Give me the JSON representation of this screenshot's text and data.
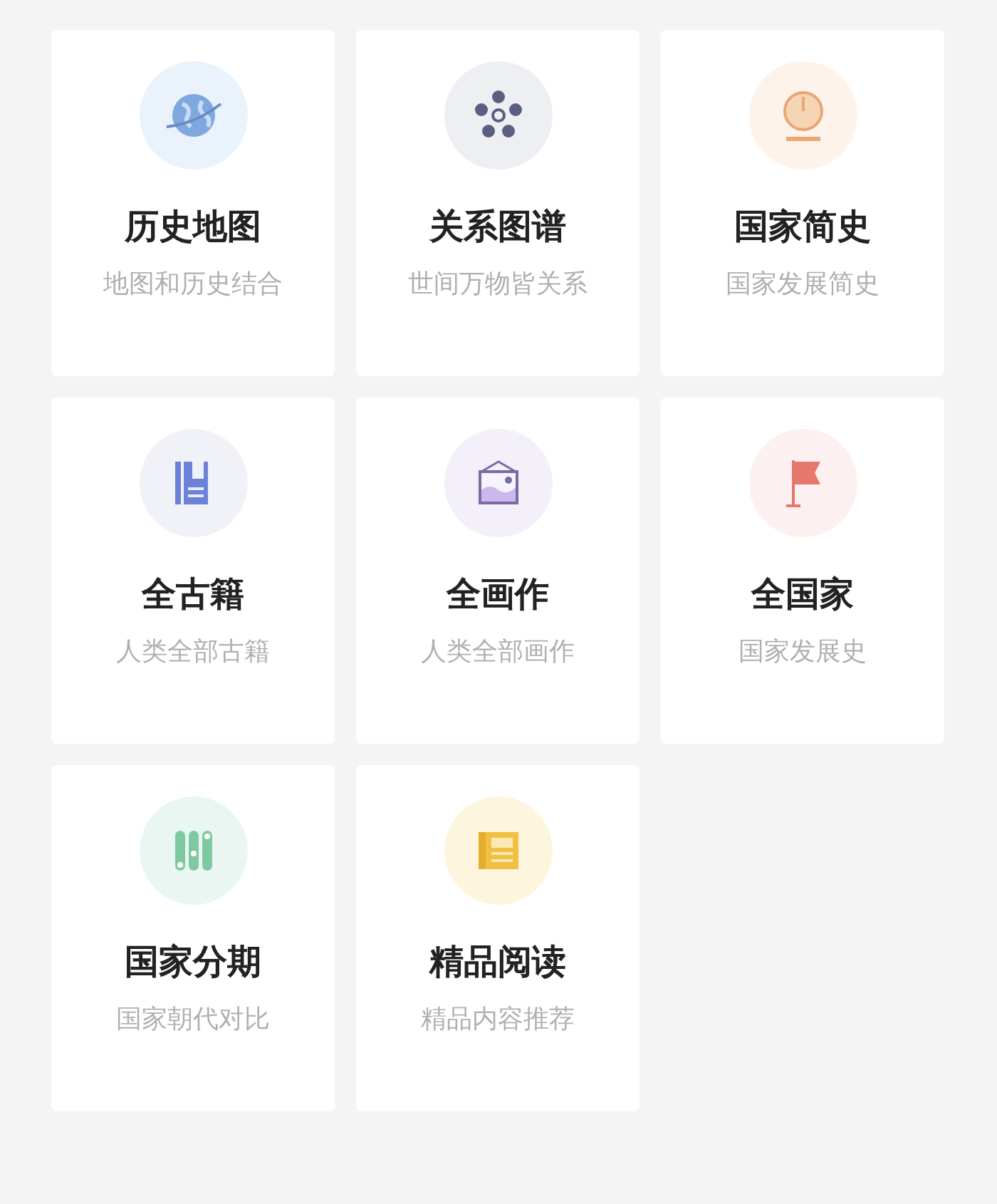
{
  "cards": [
    {
      "kind": "globe",
      "title": "历史地图",
      "subtitle": "地图和历史结合"
    },
    {
      "kind": "network",
      "title": "关系图谱",
      "subtitle": "世间万物皆关系"
    },
    {
      "kind": "clock",
      "title": "国家简史",
      "subtitle": "国家发展简史"
    },
    {
      "kind": "book",
      "title": "全古籍",
      "subtitle": "人类全部古籍"
    },
    {
      "kind": "painting",
      "title": "全画作",
      "subtitle": "人类全部画作"
    },
    {
      "kind": "flag",
      "title": "全国家",
      "subtitle": "国家发展史"
    },
    {
      "kind": "scrolls",
      "title": "国家分期",
      "subtitle": "国家朝代对比"
    },
    {
      "kind": "reading",
      "title": "精品阅读",
      "subtitle": "精品内容推荐"
    }
  ]
}
